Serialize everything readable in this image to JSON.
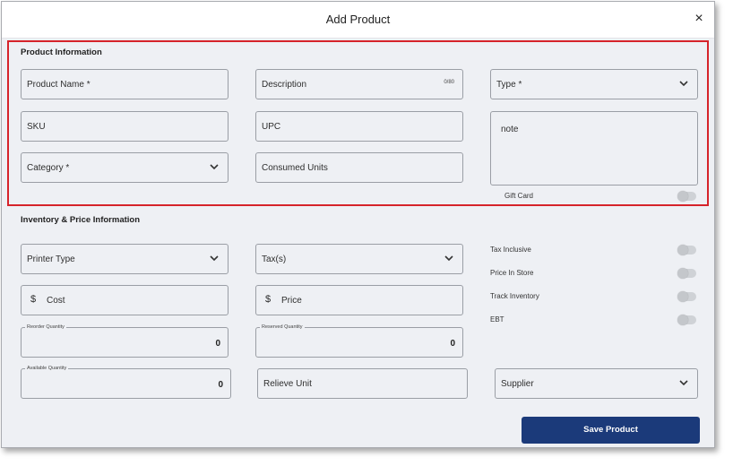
{
  "dialog": {
    "title": "Add Product",
    "close_symbol": "×"
  },
  "product_info": {
    "section_title": "Product Information",
    "product_name": "Product Name *",
    "description": "Description",
    "description_counter": "0/80",
    "type": "Type *",
    "sku": "SKU",
    "upc": "UPC",
    "note": "note",
    "category": "Category *",
    "consumed_units": "Consumed Units",
    "gift_card_label": "Gift Card"
  },
  "inventory": {
    "section_title": "Inventory & Price Information",
    "printer_type": "Printer Type",
    "taxes": "Tax(s)",
    "currency_symbol": "$",
    "cost": "Cost",
    "price": "Price",
    "reorder_quantity_label": "Reorder Quantity",
    "reorder_quantity_value": "0",
    "reserved_quantity_label": "Reserved Quantity",
    "reserved_quantity_value": "0",
    "available_quantity_label": "Available Quantity",
    "available_quantity_value": "0",
    "relieve_unit": "Relieve Unit",
    "supplier": "Supplier",
    "toggles": {
      "tax_inclusive": "Tax Inclusive",
      "price_in_store": "Price In Store",
      "track_inventory": "Track Inventory",
      "ebt": "EBT"
    }
  },
  "actions": {
    "save_label": "Save Product"
  },
  "colors": {
    "primary": "#1b3a7a",
    "highlight": "#d6232a",
    "panel": "#eef0f4"
  }
}
